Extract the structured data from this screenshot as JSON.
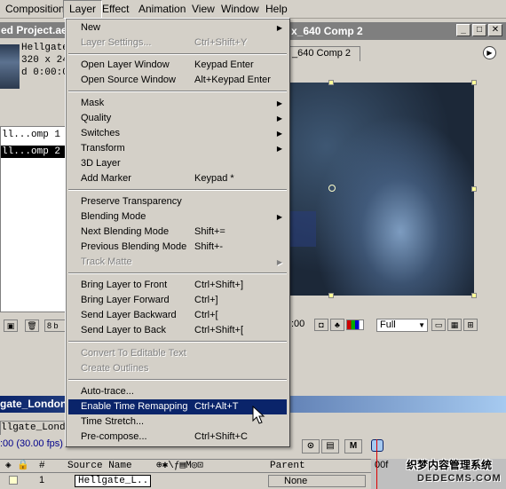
{
  "menubar": {
    "items": [
      "Composition",
      "Layer",
      "Effect",
      "Animation",
      "View",
      "Window",
      "Help"
    ]
  },
  "project": {
    "title": "ed Project.ae",
    "footage_name": "Hellgate",
    "footage_size": "320 x 24",
    "footage_dur": "d 0:00:0",
    "list": [
      "ll...omp 1  [",
      "ll...omp 2  ["
    ],
    "footer_depth": "8 b"
  },
  "comp": {
    "title": "x_640 Comp 2",
    "tab_label": "_640 Comp 2",
    "time_readout": ":00",
    "zoom": "Full"
  },
  "layer_menu": {
    "groups": [
      [
        {
          "label": "New",
          "shortcut": "",
          "submenu": true,
          "disabled": false
        },
        {
          "label": "Layer Settings...",
          "shortcut": "Ctrl+Shift+Y",
          "submenu": false,
          "disabled": true
        }
      ],
      [
        {
          "label": "Open Layer Window",
          "shortcut": "Keypad Enter",
          "submenu": false,
          "disabled": false
        },
        {
          "label": "Open Source Window",
          "shortcut": "Alt+Keypad Enter",
          "submenu": false,
          "disabled": false
        }
      ],
      [
        {
          "label": "Mask",
          "shortcut": "",
          "submenu": true,
          "disabled": false
        },
        {
          "label": "Quality",
          "shortcut": "",
          "submenu": true,
          "disabled": false
        },
        {
          "label": "Switches",
          "shortcut": "",
          "submenu": true,
          "disabled": false
        },
        {
          "label": "Transform",
          "shortcut": "",
          "submenu": true,
          "disabled": false
        },
        {
          "label": "3D Layer",
          "shortcut": "",
          "submenu": false,
          "disabled": false
        },
        {
          "label": "Add Marker",
          "shortcut": "Keypad *",
          "submenu": false,
          "disabled": false
        }
      ],
      [
        {
          "label": "Preserve Transparency",
          "shortcut": "",
          "submenu": false,
          "disabled": false
        },
        {
          "label": "Blending Mode",
          "shortcut": "",
          "submenu": true,
          "disabled": false
        },
        {
          "label": "Next Blending Mode",
          "shortcut": "Shift+=",
          "submenu": false,
          "disabled": false
        },
        {
          "label": "Previous Blending Mode",
          "shortcut": "Shift+-",
          "submenu": false,
          "disabled": false
        },
        {
          "label": "Track Matte",
          "shortcut": "",
          "submenu": true,
          "disabled": true
        }
      ],
      [
        {
          "label": "Bring Layer to Front",
          "shortcut": "Ctrl+Shift+]",
          "submenu": false,
          "disabled": false
        },
        {
          "label": "Bring Layer Forward",
          "shortcut": "Ctrl+]",
          "submenu": false,
          "disabled": false
        },
        {
          "label": "Send Layer Backward",
          "shortcut": "Ctrl+[",
          "submenu": false,
          "disabled": false
        },
        {
          "label": "Send Layer to Back",
          "shortcut": "Ctrl+Shift+[",
          "submenu": false,
          "disabled": false
        }
      ],
      [
        {
          "label": "Convert To Editable Text",
          "shortcut": "",
          "submenu": false,
          "disabled": true
        },
        {
          "label": "Create Outlines",
          "shortcut": "",
          "submenu": false,
          "disabled": true
        }
      ],
      [
        {
          "label": "Auto-trace...",
          "shortcut": "",
          "submenu": false,
          "disabled": false
        },
        {
          "label": "Enable Time Remapping",
          "shortcut": "Ctrl+Alt+T",
          "submenu": false,
          "disabled": false,
          "highlighted": true
        },
        {
          "label": "Time Stretch...",
          "shortcut": "",
          "submenu": false,
          "disabled": false
        },
        {
          "label": "Pre-compose...",
          "shortcut": "Ctrl+Shift+C",
          "submenu": false,
          "disabled": false
        }
      ]
    ]
  },
  "timeline": {
    "title": "gate_London_",
    "tab_label": "llgate_London_",
    "time": ":00  (30.00 fps)",
    "col_num": "#",
    "col_source": "Source Name",
    "col_parent": "Parent",
    "layer_index": "1",
    "layer_name": "Hellgate_L...",
    "parent_value": "None",
    "ruler_label": "00f"
  },
  "watermark": {
    "line1": "织梦内容管理系统",
    "line2": "DEDECMS.COM"
  }
}
